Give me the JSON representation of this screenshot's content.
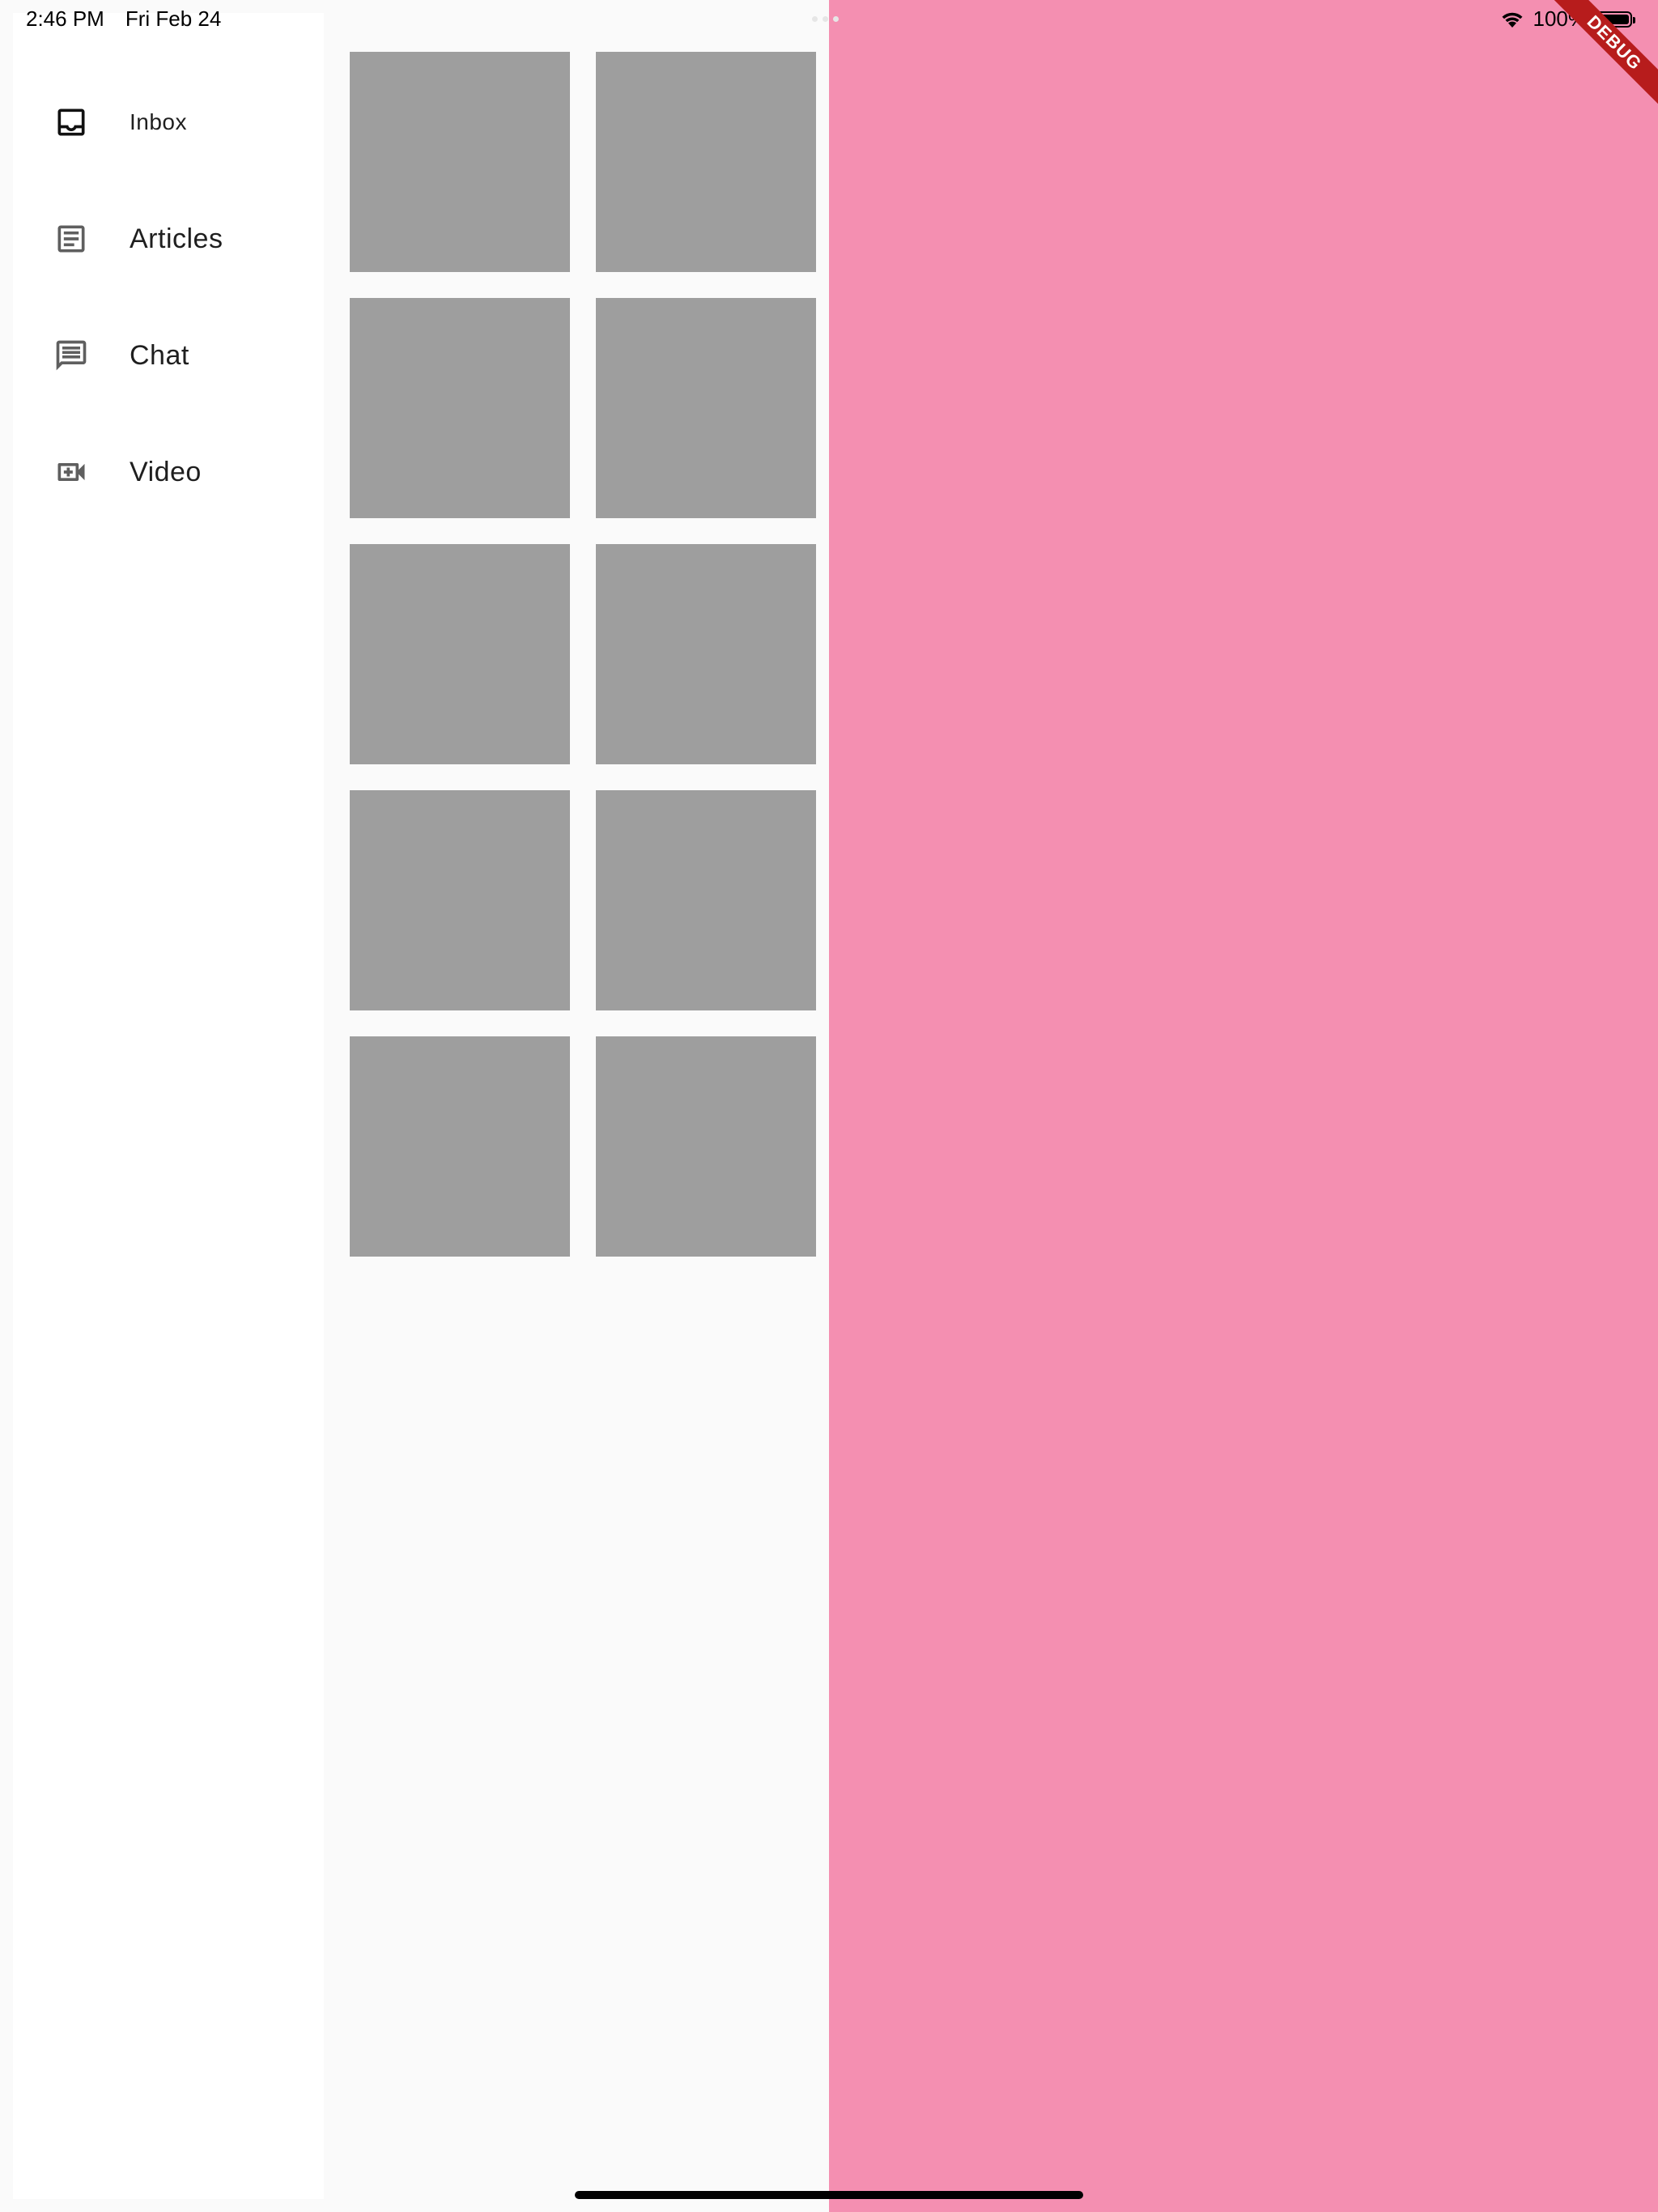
{
  "status_bar": {
    "time": "2:46 PM",
    "date": "Fri Feb 24",
    "battery": "100%",
    "battery_level": 1.0
  },
  "drawer": {
    "items": [
      {
        "label": "Inbox",
        "icon": "inbox-icon",
        "selected": true
      },
      {
        "label": "Articles",
        "icon": "article-icon",
        "selected": false
      },
      {
        "label": "Chat",
        "icon": "chat-icon",
        "selected": false
      },
      {
        "label": "Video",
        "icon": "video-call-icon",
        "selected": false
      }
    ]
  },
  "grid": {
    "tile_count": 10,
    "columns": 2,
    "tile_color": "#9e9e9e"
  },
  "detail": {
    "background_color": "#f48fb1"
  },
  "debug_banner": {
    "text": "DEBUG",
    "color": "#b71c1c"
  }
}
